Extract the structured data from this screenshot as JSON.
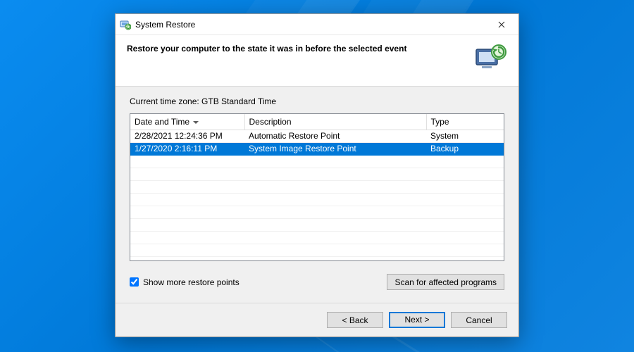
{
  "window": {
    "title": "System Restore",
    "heading": "Restore your computer to the state it was in before the selected event"
  },
  "timezone_label": "Current time zone: GTB Standard Time",
  "table": {
    "columns": {
      "date": "Date and Time",
      "description": "Description",
      "type": "Type"
    },
    "sort_column": "date",
    "sort_direction": "desc",
    "rows": [
      {
        "date": "2/28/2021 12:24:36 PM",
        "description": "Automatic Restore Point",
        "type": "System",
        "selected": false
      },
      {
        "date": "1/27/2020 2:16:11 PM",
        "description": "System Image Restore Point",
        "type": "Backup",
        "selected": true
      }
    ]
  },
  "show_more": {
    "label": "Show more restore points",
    "checked": true
  },
  "buttons": {
    "scan": "Scan for affected programs",
    "back": "< Back",
    "next": "Next >",
    "cancel": "Cancel"
  },
  "icons": {
    "app": "system-restore-icon",
    "wizard": "restore-wizard-icon",
    "close": "close-icon"
  }
}
